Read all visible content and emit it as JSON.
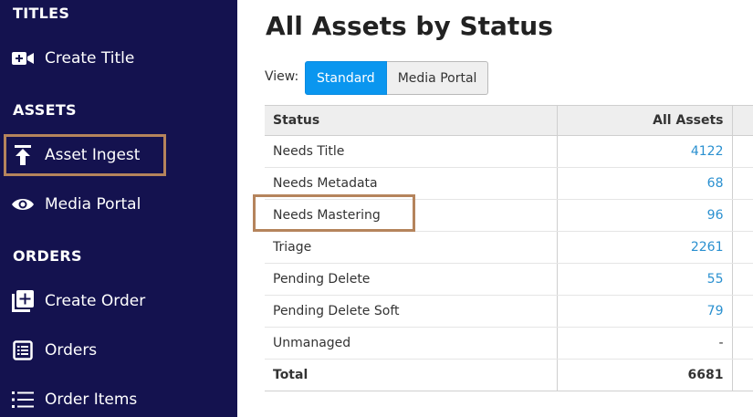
{
  "sidebar": {
    "sections": [
      {
        "label": "TITLES"
      },
      {
        "label": "ASSETS"
      },
      {
        "label": "ORDERS"
      }
    ],
    "items": [
      {
        "label": "Create Title",
        "icon": "video-plus-icon"
      },
      {
        "label": "Asset Ingest",
        "icon": "upload-icon"
      },
      {
        "label": "Media Portal",
        "icon": "eye-icon"
      },
      {
        "label": "Create Order",
        "icon": "add-box-icon"
      },
      {
        "label": "Orders",
        "icon": "list-box-icon"
      },
      {
        "label": "Order Items",
        "icon": "list-icon"
      }
    ]
  },
  "main": {
    "title": "All Assets by Status",
    "view_label": "View:",
    "views": [
      {
        "label": "Standard",
        "active": true
      },
      {
        "label": "Media Portal",
        "active": false
      }
    ],
    "table": {
      "headers": {
        "status": "Status",
        "all_assets": "All Assets"
      },
      "rows": [
        {
          "status": "Needs Title",
          "count": "4122"
        },
        {
          "status": "Needs Metadata",
          "count": "68"
        },
        {
          "status": "Needs Mastering",
          "count": "96"
        },
        {
          "status": "Triage",
          "count": "2261"
        },
        {
          "status": "Pending Delete",
          "count": "55"
        },
        {
          "status": "Pending Delete Soft",
          "count": "79"
        },
        {
          "status": "Unmanaged",
          "count": "-"
        }
      ],
      "total": {
        "label": "Total",
        "count": "6681"
      }
    }
  },
  "colors": {
    "sidebar_bg": "#14124f",
    "accent": "#0a96ef",
    "link": "#2a90d0",
    "highlight_border": "#b5845c"
  }
}
